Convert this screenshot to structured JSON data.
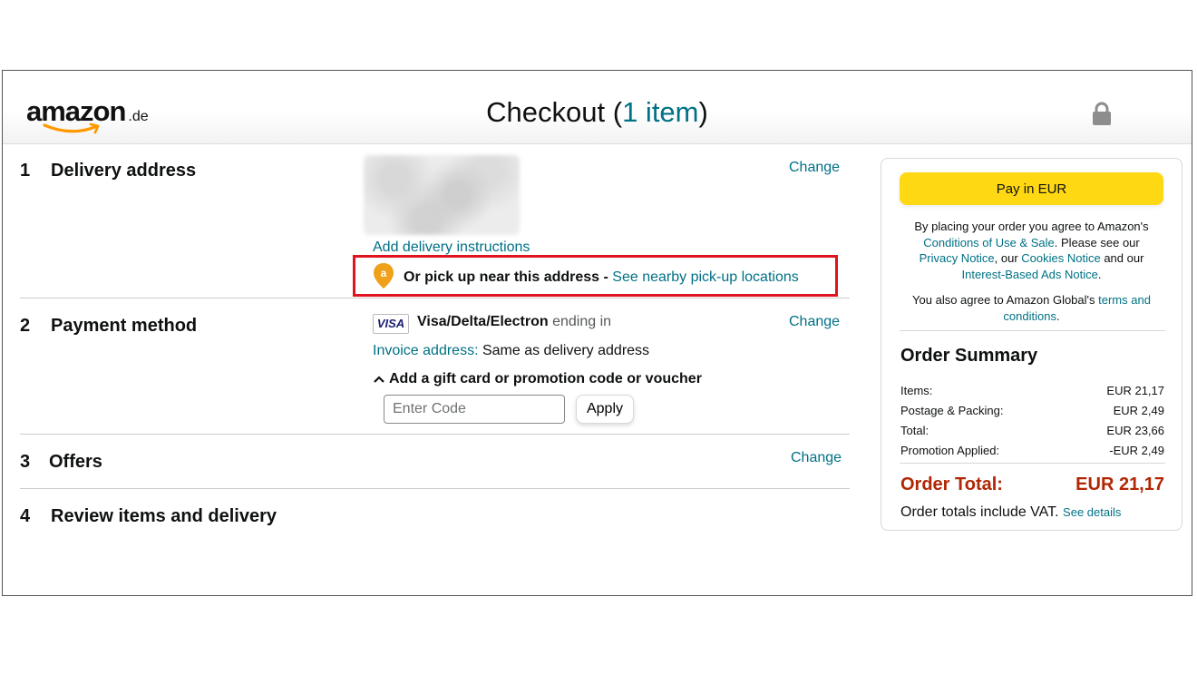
{
  "header": {
    "logo_word": "amazon",
    "logo_tld": ".de",
    "title_prefix": "Checkout (",
    "item_count": "1 item",
    "title_suffix": ")",
    "lock_icon": "lock-icon"
  },
  "steps": {
    "delivery": {
      "number": "1",
      "title": "Delivery address",
      "change": "Change",
      "add_instructions": "Add delivery instructions",
      "pickup_text": "Or pick up near this address - ",
      "pickup_link": "See nearby pick-up locations"
    },
    "payment": {
      "number": "2",
      "title": "Payment method",
      "change": "Change",
      "card_brand": "VISA",
      "card_name": "Visa/Delta/Electron",
      "card_suffix": " ending in",
      "invoice_label": "Invoice address:",
      "invoice_value": " Same as delivery address",
      "gift_toggle": "Add a gift card or promotion code or voucher",
      "code_placeholder": "Enter Code",
      "apply": "Apply"
    },
    "offers": {
      "number": "3",
      "title": "Offers",
      "change": "Change"
    },
    "review": {
      "number": "4",
      "title": "Review items and delivery"
    }
  },
  "panel": {
    "pay_button": "Pay in EUR",
    "legal1": "By placing your order you agree to Amazon's",
    "legal_conditions": "Conditions of Use & Sale",
    "legal2": ". Please see our",
    "legal_privacy": "Privacy Notice",
    "legal3": ", our ",
    "legal_cookies": "Cookies Notice",
    "legal4": " and our",
    "legal_ads": "Interest-Based Ads Notice",
    "legal5": ".",
    "legal_global": "You also agree to Amazon Global's ",
    "legal_terms": "terms and conditions",
    "legal6": ".",
    "summary_title": "Order Summary",
    "rows": [
      {
        "label": "Items:",
        "value": "EUR 21,17"
      },
      {
        "label": "Postage & Packing:",
        "value": "EUR 2,49"
      },
      {
        "label": "Total:",
        "value": "EUR 23,66"
      },
      {
        "label": "Promotion Applied:",
        "value": "-EUR 2,49"
      }
    ],
    "order_total_label": "Order Total:",
    "order_total_value": "EUR 21,17",
    "vat_text": "Order totals include VAT. ",
    "vat_link": "See details"
  },
  "colors": {
    "link": "#007185",
    "highlight_border": "#e0141e",
    "pay_button": "#ffd814",
    "total": "#b12704"
  }
}
